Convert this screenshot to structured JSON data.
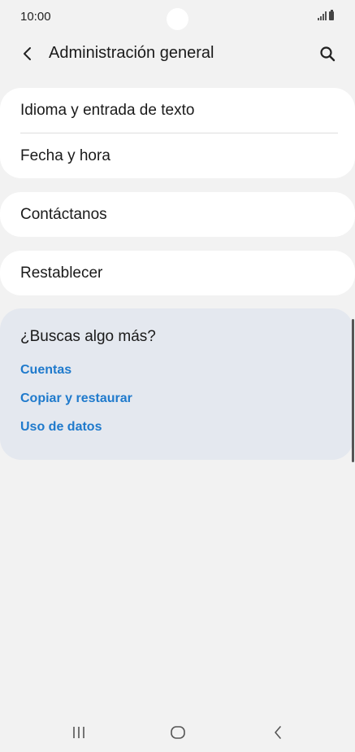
{
  "status_bar": {
    "time": "10:00"
  },
  "header": {
    "title": "Administración general"
  },
  "groups": [
    {
      "items": [
        "Idioma y entrada de texto",
        "Fecha y hora"
      ]
    },
    {
      "items": [
        "Contáctanos"
      ]
    },
    {
      "items": [
        "Restablecer"
      ]
    }
  ],
  "suggestions": {
    "title": "¿Buscas algo más?",
    "links": [
      "Cuentas",
      "Copiar y restaurar",
      "Uso de datos"
    ]
  },
  "colors": {
    "background": "#f2f2f2",
    "card": "#ffffff",
    "suggestion_card": "#e4e8ef",
    "link": "#1f7acc"
  },
  "icons": {
    "back": "back-arrow-icon",
    "search": "search-icon",
    "recents": "recents-icon",
    "home": "home-icon",
    "nav_back": "nav-back-icon"
  }
}
